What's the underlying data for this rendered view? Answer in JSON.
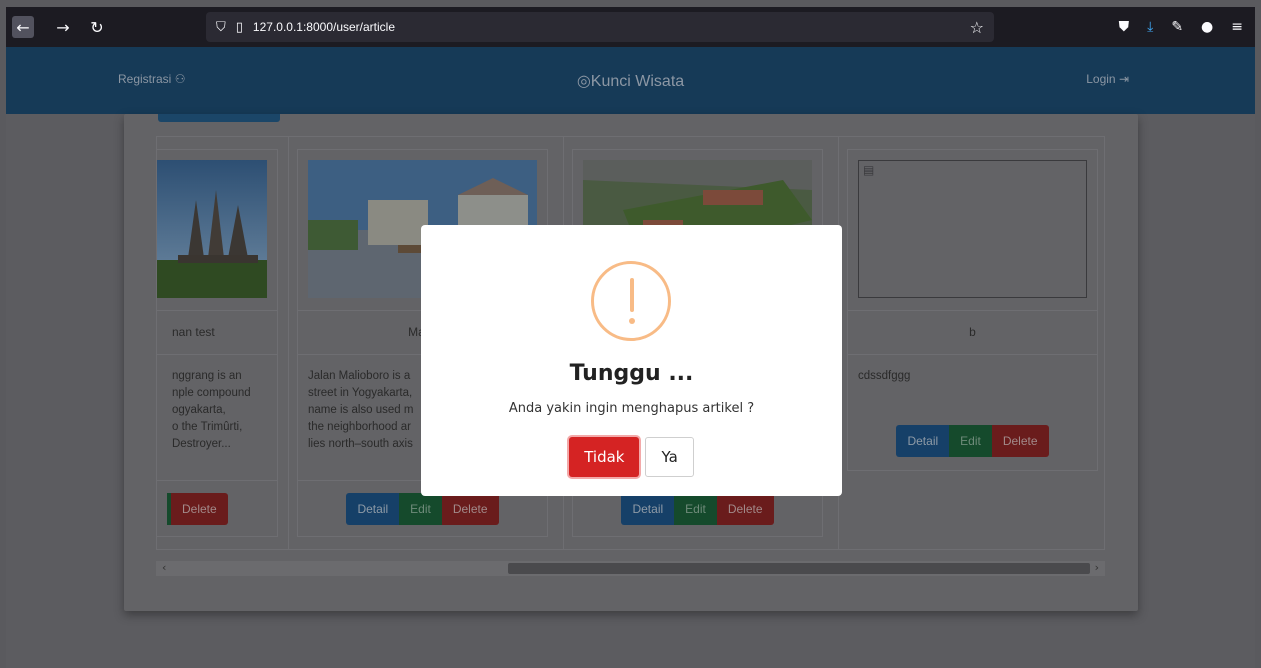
{
  "browser": {
    "url": "127.0.0.1:8000/user/article"
  },
  "header": {
    "register": "Registrasi",
    "brand": "Kunci Wisata",
    "login": "Login"
  },
  "cards": [
    {
      "title": "nan test",
      "desc": "nggrang is an\nnple compound\nogyakarta,\no the Trimûrti,\nDestroyer...",
      "buttons": {
        "delete": "Delete"
      }
    },
    {
      "title": "Malio",
      "desc": "Jalan Malioboro is a\nstreet in Yogyakarta,\nname is also used m\nthe neighborhood ar\nlies north–south axis",
      "buttons": {
        "detail": "Detail",
        "edit": "Edit",
        "delete": "Delete"
      }
    },
    {
      "title": "",
      "desc": "",
      "buttons": {
        "detail": "Detail",
        "edit": "Edit",
        "delete": "Delete"
      }
    },
    {
      "title": "b",
      "desc": "cdssdfggg",
      "buttons": {
        "detail": "Detail",
        "edit": "Edit",
        "delete": "Delete"
      }
    }
  ],
  "modal": {
    "title": "Tunggu ...",
    "text": "Anda yakin ingin menghapus artikel ?",
    "cancel": "Tidak",
    "confirm": "Ya"
  },
  "colors": {
    "header": "#163a57",
    "danger": "#d52323",
    "warning": "#f8bb86"
  }
}
